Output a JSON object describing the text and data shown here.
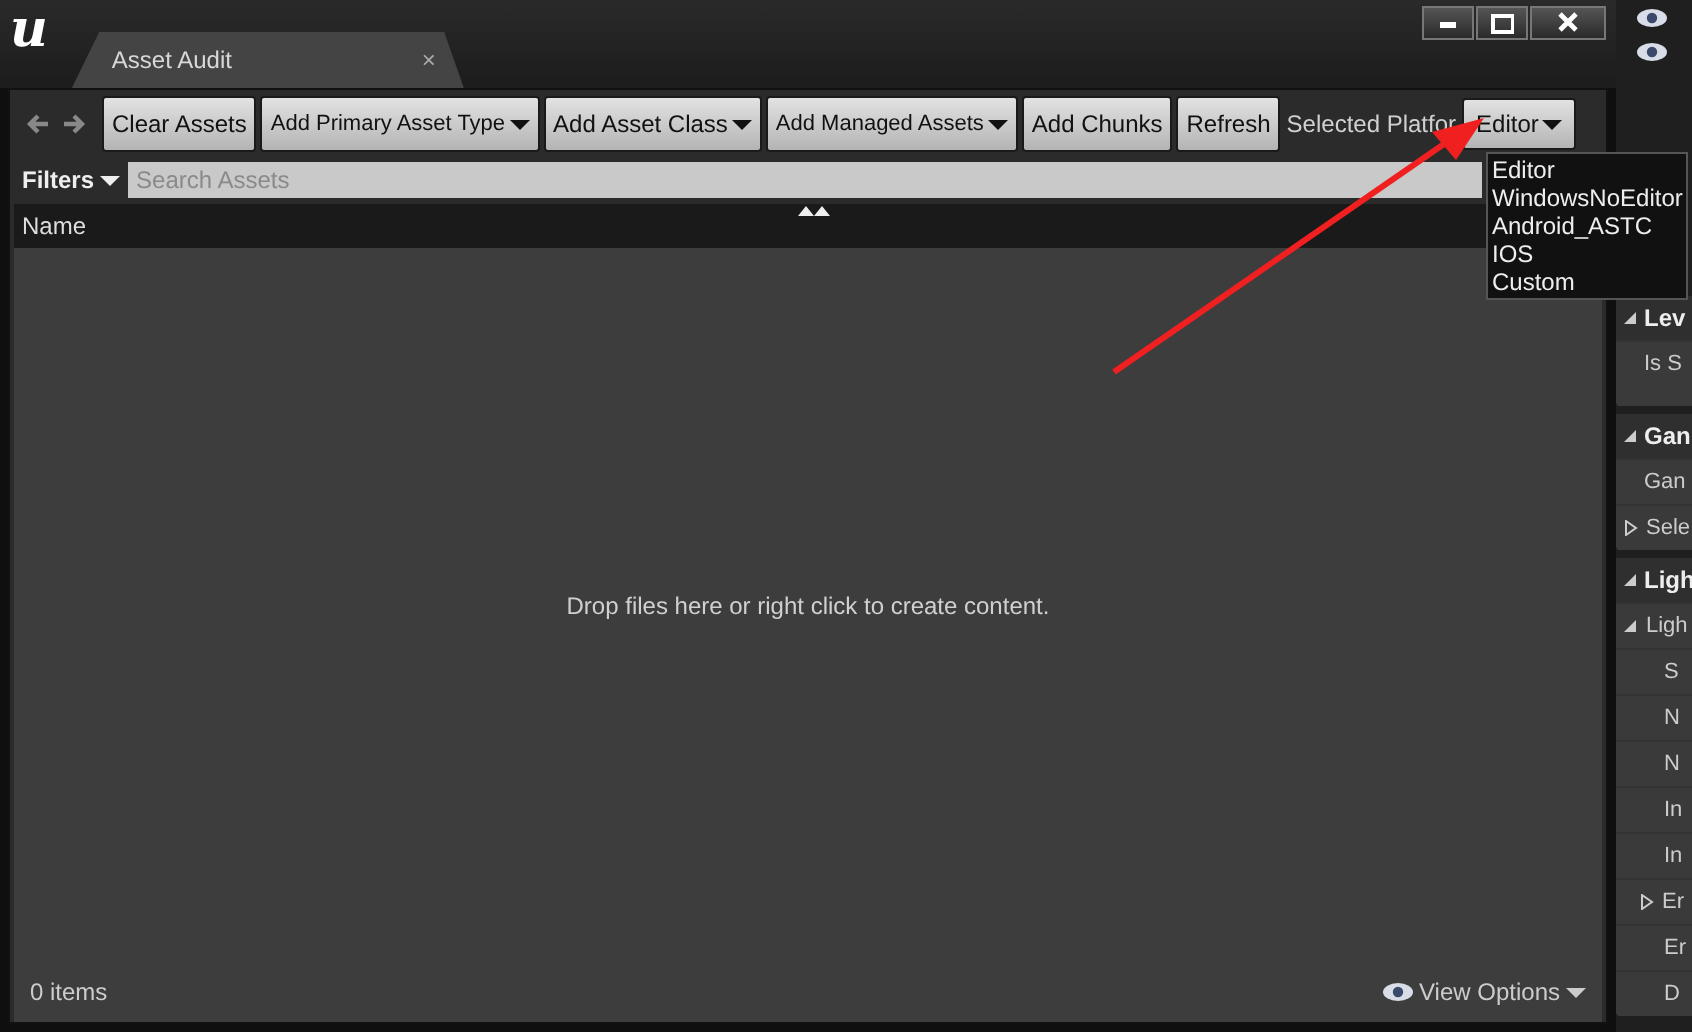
{
  "window": {
    "logo": "u",
    "tabs": [
      {
        "label": "Asset Audit",
        "selected": true,
        "close": "×"
      }
    ]
  },
  "toolbar": {
    "buttons": [
      {
        "label": "Clear Assets",
        "dropdown": false
      },
      {
        "label": "Add Primary Asset Type",
        "dropdown": true
      },
      {
        "label": "Add Asset Class",
        "dropdown": true
      },
      {
        "label": "Add Managed Assets",
        "dropdown": true
      },
      {
        "label": "Add Chunks",
        "dropdown": false
      },
      {
        "label": "Refresh",
        "dropdown": false
      }
    ],
    "platform_label": "Selected Platfor",
    "platform": {
      "value": "Editor"
    }
  },
  "filters": {
    "label": "Filters",
    "placeholder": "Search Assets"
  },
  "columns": [
    {
      "label": "Name"
    }
  ],
  "empty_message": "Drop files here or right click to create content.",
  "status_bar": {
    "count": "0 items",
    "view_options": "View Options"
  },
  "platform_menu": {
    "items": [
      "Editor",
      "WindowsNoEditor",
      "Android_ASTC",
      "IOS",
      "Custom"
    ]
  },
  "side_panel": {
    "sections": [
      {
        "title": "Lev",
        "expanded": true,
        "rows": [
          {
            "label": "Is S"
          }
        ]
      },
      {
        "title": "Gan",
        "expanded": true,
        "rows": [
          {
            "label": "Gan"
          },
          {
            "label": "Sele",
            "expanded": false
          }
        ]
      },
      {
        "title": "Ligh",
        "expanded": true,
        "rows": [
          {
            "label": "Ligh",
            "expanded": true,
            "children": [
              {
                "label": "S"
              },
              {
                "label": "N"
              },
              {
                "label": "N"
              },
              {
                "label": "In"
              },
              {
                "label": "In"
              },
              {
                "label": "Er",
                "expanded": false
              },
              {
                "label": "Er"
              },
              {
                "label": "D"
              }
            ]
          }
        ]
      }
    ]
  }
}
